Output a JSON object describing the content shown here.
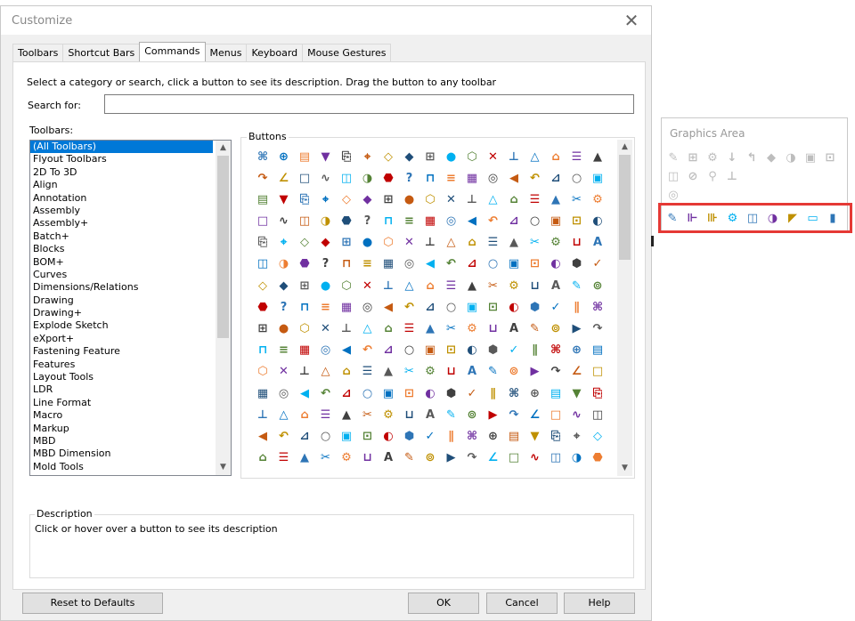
{
  "dialog": {
    "title": "Customize"
  },
  "tabs": [
    "Toolbars",
    "Shortcut Bars",
    "Commands",
    "Menus",
    "Keyboard",
    "Mouse Gestures"
  ],
  "active_tab": "Commands",
  "instructions": "Select a category or search, click a button to see its description. Drag the button to any toolbar",
  "search": {
    "label": "Search for:",
    "value": ""
  },
  "toolbars_label": "Toolbars:",
  "toolbar_list": [
    "(All Toolbars)",
    "Flyout Toolbars",
    "2D To 3D",
    "Align",
    "Annotation",
    "Assembly",
    "Assembly+",
    "Batch+",
    "Blocks",
    "BOM+",
    "Curves",
    "Dimensions/Relations",
    "Drawing",
    "Drawing+",
    "Explode Sketch",
    "eXport+",
    "Fastening Feature",
    "Features",
    "Layout Tools",
    "LDR",
    "Line Format",
    "Macro",
    "Markup",
    "MBD",
    "MBD Dimension",
    "Mold Tools"
  ],
  "selected_toolbar": "(All Toolbars)",
  "buttons_label": "Buttons",
  "description": {
    "label": "Description",
    "text": "Click or hover over a button to see its description"
  },
  "footer": {
    "reset": "Reset to Defaults",
    "ok": "OK",
    "cancel": "Cancel",
    "help": "Help"
  },
  "graphics_area": {
    "title": "Graphics Area"
  },
  "colors": {
    "accent": "#0078d7",
    "highlight": "#e53935"
  },
  "icon_glyphs": [
    "⌘",
    "≡",
    "A",
    "◆",
    "▣",
    "∿",
    "⌂",
    "⊕",
    "▦",
    "✎",
    "⊞",
    "⊡",
    "◫",
    "☰",
    "▤",
    "◎",
    "⊚",
    "●",
    "◐",
    "◑",
    "▲",
    "▼",
    "◀",
    "▶",
    "⬡",
    "⬢",
    "⬣",
    "✂",
    "⎘",
    "↶",
    "↷",
    "✕",
    "✓",
    "?",
    "⚙",
    "⌖",
    "⊿",
    "∠",
    "⊥",
    "∥",
    "⊓",
    "⊔",
    "◇",
    "○",
    "□",
    "△"
  ],
  "icon_colors": [
    "#1f4e79",
    "#2e75b6",
    "#c55a11",
    "#548235",
    "#7030a0",
    "#595959",
    "#0070c0",
    "#bf9000",
    "#c00000",
    "#404040",
    "#00b0f0",
    "#ed7d31"
  ],
  "graphics_area_icons": [
    "✎",
    "⊞",
    "⚙",
    "↓",
    "↰",
    "◆",
    "◑",
    "▣",
    "⊡",
    "◫",
    "⊘",
    "⚲",
    "⊥",
    "◎",
    "◉"
  ],
  "graphics_area_highlight_icons": [
    "✎",
    "⊩",
    "⊪",
    "⚙",
    "◫",
    "◑",
    "◤",
    "▭",
    "▮"
  ]
}
